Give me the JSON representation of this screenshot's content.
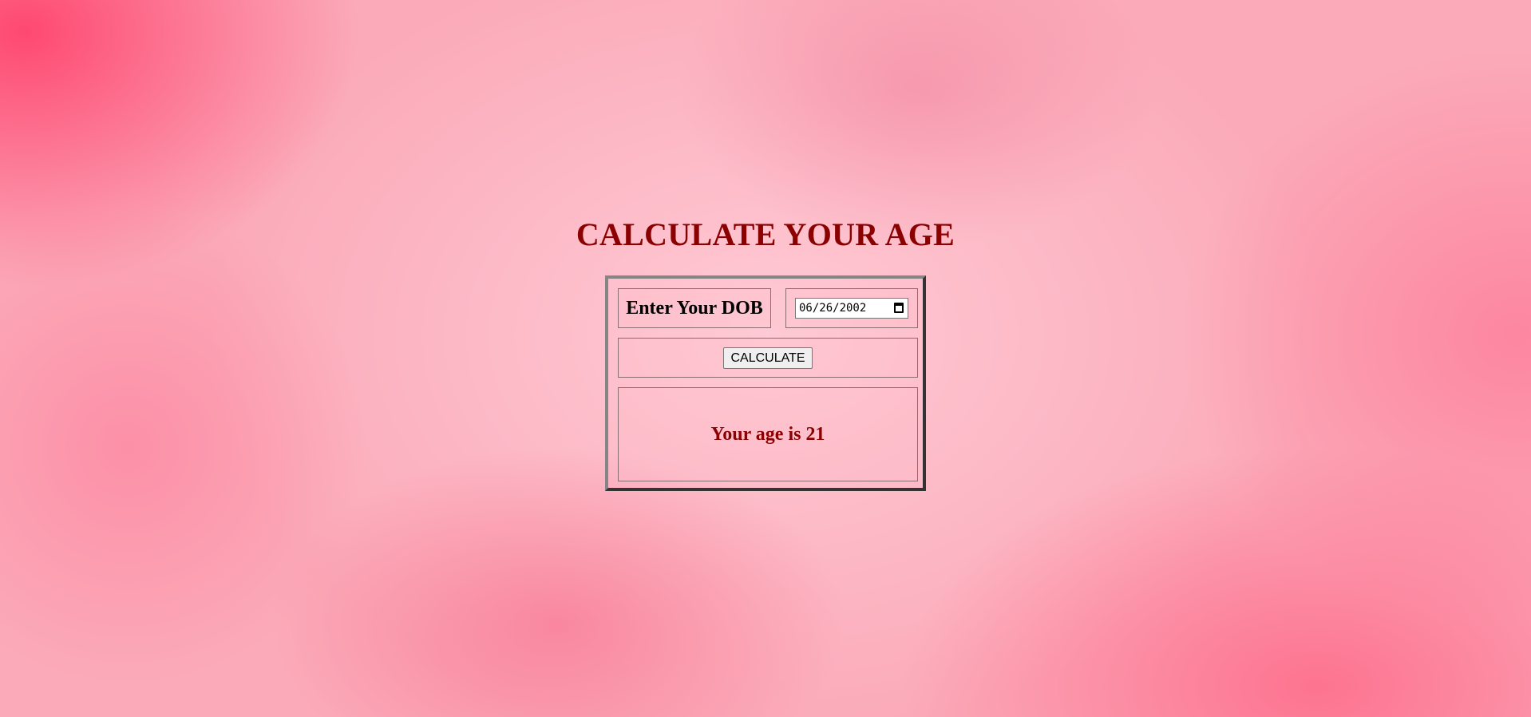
{
  "page": {
    "title": "CALCULATE YOUR AGE"
  },
  "form": {
    "dob_label": "Enter Your DOB",
    "dob_value": "06/26/2002",
    "calculate_label": "CALCULATE",
    "result_text": "Your age is 21"
  },
  "icons": {
    "date_picker": "calendar-icon"
  },
  "colors": {
    "title": "#8b0000",
    "result": "#8b0000",
    "background": "#fbaab9"
  }
}
